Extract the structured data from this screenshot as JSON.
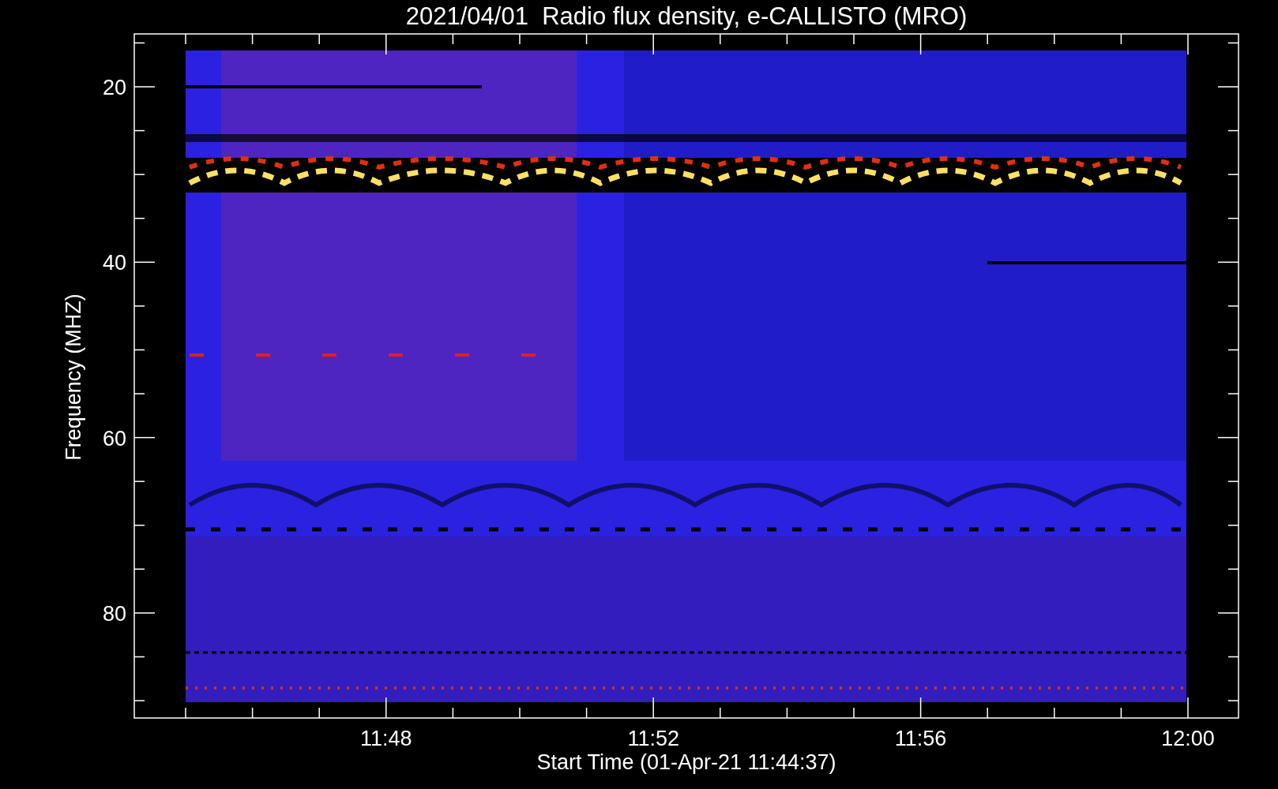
{
  "title": "2021/04/01  Radio flux density, e-CALLISTO (MRO)",
  "y_axis": {
    "label": "Frequency (MHZ)",
    "ticks": [
      "20",
      "40",
      "60",
      "80"
    ]
  },
  "x_axis": {
    "label": "Start Time (01-Apr-21 11:44:37)",
    "ticks": [
      "11:48",
      "11:52",
      "11:56",
      "12:00"
    ]
  }
}
